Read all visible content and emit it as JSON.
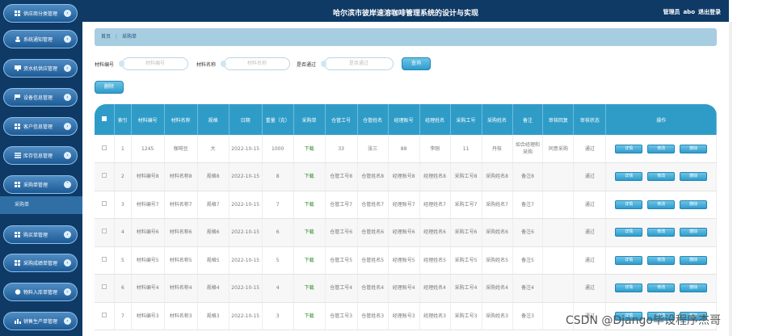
{
  "header": {
    "title": "哈尔滨市彼岸速溶咖啡管理系统的设计与实现",
    "user_role": "管理员",
    "user_name": "abo",
    "logout": "退出登录"
  },
  "sidebar": {
    "items": [
      {
        "label": "供应商分类管理",
        "icon": "grid-icon"
      },
      {
        "label": "系统通知管理",
        "icon": "user-icon"
      },
      {
        "label": "资水机供应管理",
        "icon": "monitor-icon"
      },
      {
        "label": "设备信息管理",
        "icon": "flag-icon"
      },
      {
        "label": "客户信息管理",
        "icon": "grid-icon"
      },
      {
        "label": "库存信息管理",
        "icon": "list-icon"
      },
      {
        "label": "采购单管理",
        "icon": "grid-icon"
      },
      {
        "label": "购买单管理",
        "icon": "grid-icon"
      },
      {
        "label": "采购成绩单管理",
        "icon": "grid-icon"
      },
      {
        "label": "物料入库单管理",
        "icon": "circle-icon"
      },
      {
        "label": "销售生产单管理",
        "icon": "bar-chart-icon"
      }
    ],
    "sub_item": "采购单"
  },
  "breadcrumb": {
    "home": "首页",
    "separator": "⋮",
    "current": "采购单"
  },
  "search": {
    "material_no_label": "材料编号",
    "material_no_placeholder": "材料编号",
    "material_name_label": "材料名称",
    "material_name_placeholder": "材料名称",
    "approved_label": "是否通过",
    "approved_placeholder": "是否通过",
    "query_button": "查询"
  },
  "delete_button": "删除",
  "table": {
    "headers": [
      "索引",
      "材料编号",
      "材料名称",
      "规格",
      "日期",
      "重量（克）",
      "采购单",
      "仓管工号",
      "仓管姓名",
      "经理账号",
      "经理姓名",
      "采购工号",
      "采购姓名",
      "备注",
      "审核回复",
      "审核状态",
      "操作"
    ],
    "rows": [
      {
        "idx": "1",
        "no": "1245",
        "name": "咖啡豆",
        "spec": "大",
        "date": "2022-10-15",
        "weight": "1000",
        "doc": "下载",
        "wk_no": "33",
        "wk_name": "张三",
        "mgr_no": "88",
        "mgr_name": "李刚",
        "buy_no": "11",
        "buy_name": "丹枝",
        "note": "如合经理和采购",
        "reply": "同意采购",
        "status": "通过"
      },
      {
        "idx": "2",
        "no": "材料编号8",
        "name": "材料名称8",
        "spec": "规格8",
        "date": "2022-10-15",
        "weight": "8",
        "doc": "下载",
        "wk_no": "仓管工号8",
        "wk_name": "仓管姓名8",
        "mgr_no": "经理账号8",
        "mgr_name": "经理姓名8",
        "buy_no": "采购工号8",
        "buy_name": "采购姓名8",
        "note": "备注8",
        "reply": "",
        "status": "通过"
      },
      {
        "idx": "3",
        "no": "材料编号7",
        "name": "材料名称7",
        "spec": "规格7",
        "date": "2022-10-15",
        "weight": "7",
        "doc": "下载",
        "wk_no": "仓管工号7",
        "wk_name": "仓管姓名7",
        "mgr_no": "经理账号7",
        "mgr_name": "经理姓名7",
        "buy_no": "采购工号7",
        "buy_name": "采购姓名7",
        "note": "备注7",
        "reply": "",
        "status": "通过"
      },
      {
        "idx": "4",
        "no": "材料编号6",
        "name": "材料名称6",
        "spec": "规格6",
        "date": "2022-10-15",
        "weight": "6",
        "doc": "下载",
        "wk_no": "仓管工号6",
        "wk_name": "仓管姓名6",
        "mgr_no": "经理账号6",
        "mgr_name": "经理姓名6",
        "buy_no": "采购工号6",
        "buy_name": "采购姓名6",
        "note": "备注6",
        "reply": "",
        "status": "通过"
      },
      {
        "idx": "5",
        "no": "材料编号5",
        "name": "材料名称5",
        "spec": "规格5",
        "date": "2022-10-15",
        "weight": "5",
        "doc": "下载",
        "wk_no": "仓管工号5",
        "wk_name": "仓管姓名5",
        "mgr_no": "经理账号5",
        "mgr_name": "经理姓名5",
        "buy_no": "采购工号5",
        "buy_name": "采购姓名5",
        "note": "备注5",
        "reply": "",
        "status": "通过"
      },
      {
        "idx": "6",
        "no": "材料编号4",
        "name": "材料名称4",
        "spec": "规格4",
        "date": "2022-10-15",
        "weight": "4",
        "doc": "下载",
        "wk_no": "仓管工号4",
        "wk_name": "仓管姓名4",
        "mgr_no": "经理账号4",
        "mgr_name": "经理姓名4",
        "buy_no": "采购工号4",
        "buy_name": "采购姓名4",
        "note": "备注4",
        "reply": "",
        "status": "通过"
      },
      {
        "idx": "7",
        "no": "材料编号3",
        "name": "材料名称3",
        "spec": "规格3",
        "date": "2022-10-15",
        "weight": "3",
        "doc": "下载",
        "wk_no": "仓管工号3",
        "wk_name": "仓管姓名3",
        "mgr_no": "经理账号3",
        "mgr_name": "经理姓名3",
        "buy_no": "采购工号3",
        "buy_name": "采购姓名3",
        "note": "备注3",
        "reply": "",
        "status": "通过"
      }
    ],
    "op_labels": {
      "detail": "详情",
      "edit": "修改",
      "delete": "删除"
    }
  },
  "watermark": "CSDN @Django毕设程序杰哥",
  "colors": {
    "sidebar_bg": "#0f3a66",
    "table_header": "#2f9cc7",
    "button": "#2e9ccc",
    "download": "#2a8a2a"
  }
}
